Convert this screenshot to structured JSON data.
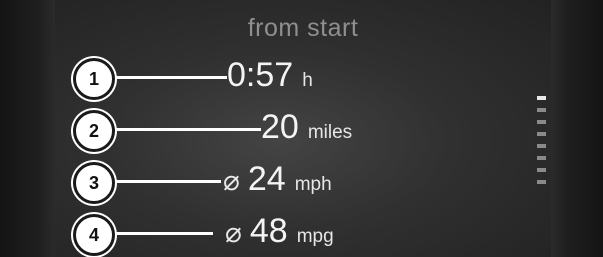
{
  "header": {
    "title": "from start"
  },
  "rows": [
    {
      "callout": "1",
      "diameter": "",
      "value": "0:57",
      "unit": "h"
    },
    {
      "callout": "2",
      "diameter": "",
      "value": "20",
      "unit": "miles"
    },
    {
      "callout": "3",
      "diameter": "⌀",
      "value": "24",
      "unit": "mph"
    },
    {
      "callout": "4",
      "diameter": "⌀",
      "value": "48",
      "unit": "mpg"
    }
  ],
  "scroll_indicator": {
    "ticks": 8,
    "active_index": 0
  },
  "colors": {
    "text": "#f4f4f4",
    "title": "#8f8f8f",
    "background": "#2b2b2b"
  }
}
